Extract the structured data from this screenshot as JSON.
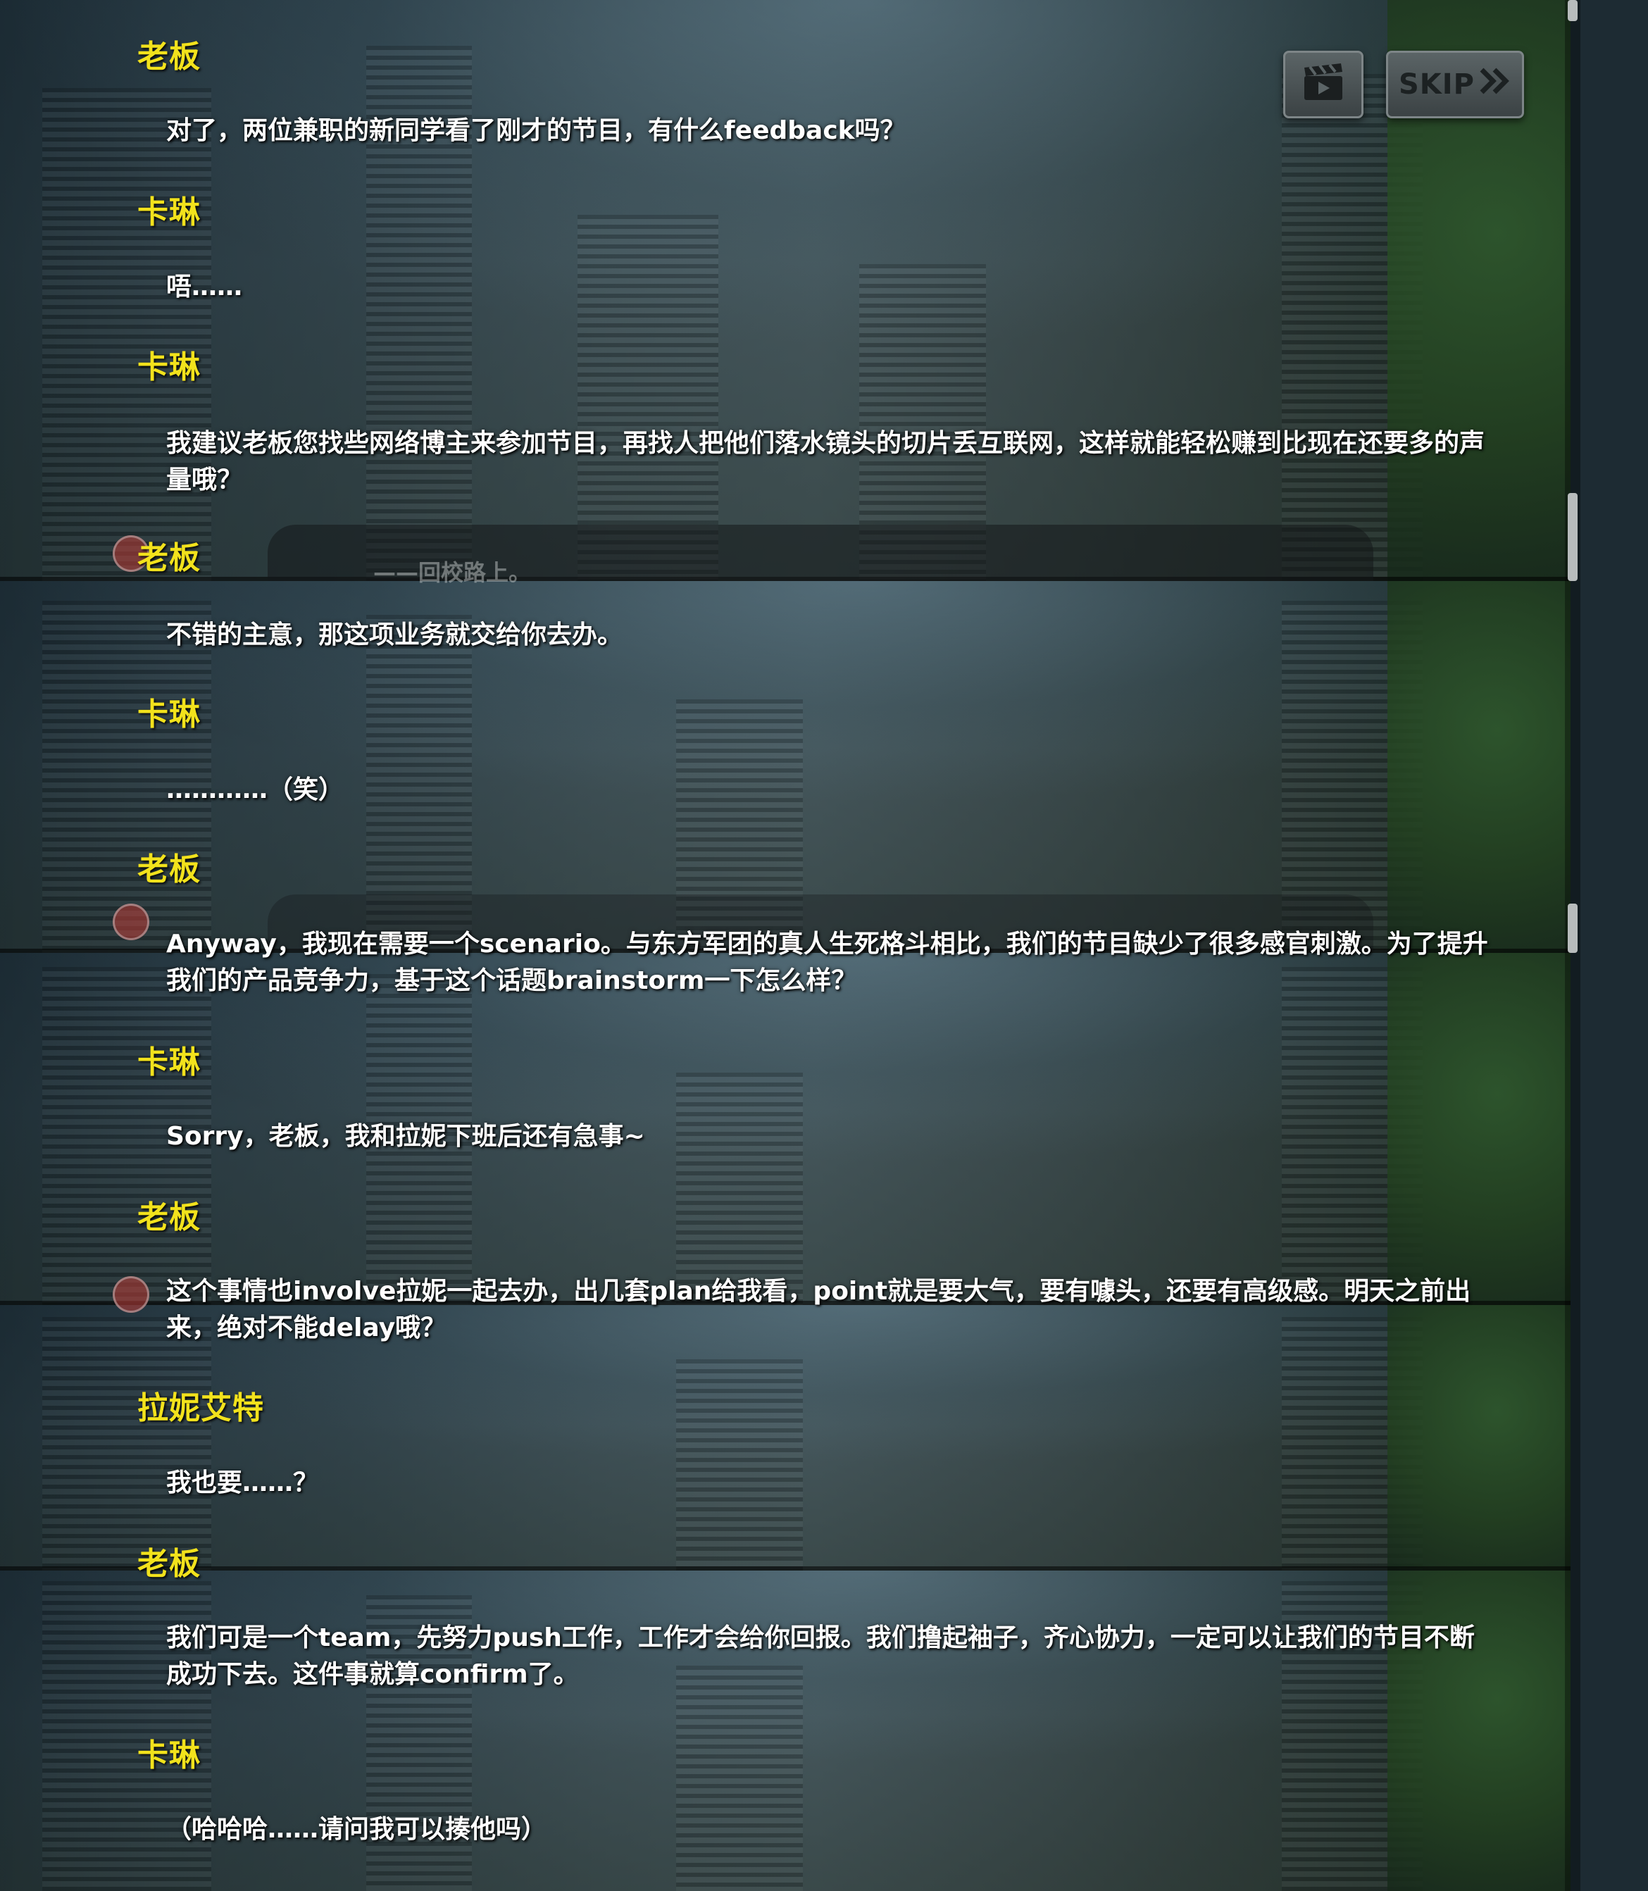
{
  "controls": {
    "clip_icon": "clapperboard-icon",
    "skip_label": "SKIP",
    "skip_icon": "double-chevron-right-icon"
  },
  "ghost_text": "——回校路上。",
  "dialogue": [
    {
      "speaker": "老板",
      "text": "对了，两位兼职的新同学看了刚才的节目，有什么feedback吗？"
    },
    {
      "speaker": "卡琳",
      "text": "唔……"
    },
    {
      "speaker": "卡琳",
      "text": "我建议老板您找些网络博主来参加节目，再找人把他们落水镜头的切片丢互联网，这样就能轻松赚到比现在还要多的声量哦？"
    },
    {
      "speaker": "老板",
      "text": "不错的主意，那这项业务就交给你去办。"
    },
    {
      "speaker": "卡琳",
      "text": "…………（笑）"
    },
    {
      "speaker": "老板",
      "text": "Anyway，我现在需要一个scenario。与东方军团的真人生死格斗相比，我们的节目缺少了很多感官刺激。为了提升我们的产品竞争力，基于这个话题brainstorm一下怎么样？"
    },
    {
      "speaker": "卡琳",
      "text": "Sorry，老板，我和拉妮下班后还有急事~"
    },
    {
      "speaker": "老板",
      "text": "这个事情也involve拉妮一起去办，出几套plan给我看，point就是要大气，要有噱头，还要有高级感。明天之前出来，绝对不能delay哦？"
    },
    {
      "speaker": "拉妮艾特",
      "text": "我也要……？"
    },
    {
      "speaker": "老板",
      "text": "我们可是一个team，先努力push工作，工作才会给你回报。我们撸起袖子，齐心协力，一定可以让我们的节目不断成功下去。这件事就算confirm了。"
    },
    {
      "speaker": "卡琳",
      "text": "（哈哈哈……请问我可以揍他吗）"
    }
  ]
}
